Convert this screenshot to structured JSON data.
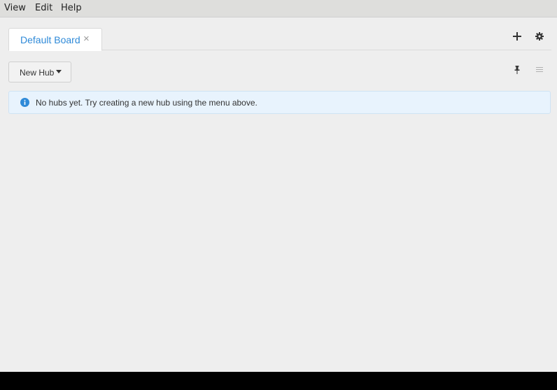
{
  "menubar": {
    "items": [
      {
        "label": "View"
      },
      {
        "label": "Edit"
      },
      {
        "label": "Help"
      }
    ]
  },
  "board": {
    "tabs": [
      {
        "label": "Default Board",
        "active": true
      }
    ],
    "actions": {
      "add_icon": "plus-icon",
      "settings_icon": "gear-icon"
    }
  },
  "toolbar": {
    "new_hub_label": "New Hub",
    "new_hub_icon": "caret-down-icon",
    "pin_icon": "pin-icon",
    "menu_icon": "hamburger-menu-icon"
  },
  "notice": {
    "icon": "info-icon",
    "message": "No hubs yet. Try creating a new hub using the menu above."
  },
  "colors": {
    "accent": "#2f8ad8",
    "info_bg": "#e8f3fd",
    "app_bg": "#eeeeee",
    "menubar_bg": "#dededc"
  }
}
